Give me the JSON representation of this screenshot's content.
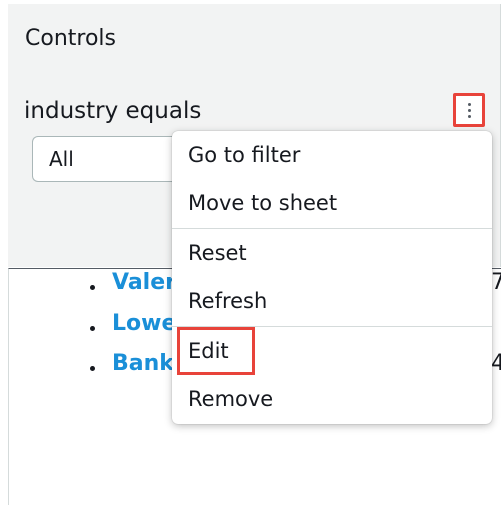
{
  "controls": {
    "title": "Controls",
    "filter_label": "industry equals",
    "selected_value": "All",
    "menu_button_icon": "kebab-menu-icon"
  },
  "menu": {
    "items": [
      {
        "label": "Go to filter"
      },
      {
        "label": "Move to sheet"
      },
      {
        "label": "Reset"
      },
      {
        "label": "Refresh"
      },
      {
        "label": "Edit"
      },
      {
        "label": "Remove"
      }
    ]
  },
  "sheet": {
    "list": [
      {
        "label": "Valer",
        "value": "7"
      },
      {
        "label": "Lowe",
        "value": ""
      },
      {
        "label": "Bank",
        "value": "4"
      }
    ]
  },
  "colors": {
    "highlight": "#e8433a",
    "link": "#1a8fd8",
    "panel_bg": "#f2f3f3"
  }
}
